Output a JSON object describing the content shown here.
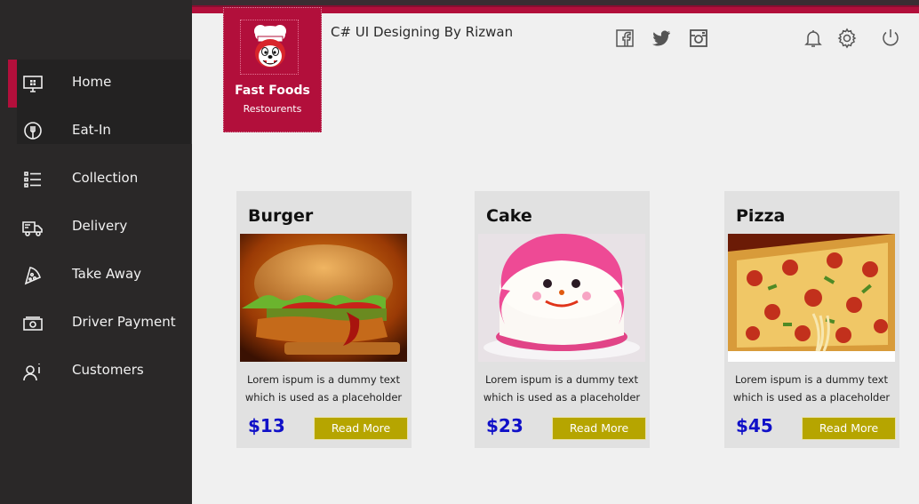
{
  "app": {
    "title": "C# UI Designing By Rizwan"
  },
  "brand": {
    "name": "Fast Foods",
    "subtitle": "Restourents",
    "color": "#b20f3b"
  },
  "sidebar": {
    "items": [
      {
        "label": "Home",
        "icon": "monitor-icon",
        "active": true
      },
      {
        "label": "Eat-In",
        "icon": "dine-in-icon"
      },
      {
        "label": "Collection",
        "icon": "list-icon"
      },
      {
        "label": "Delivery",
        "icon": "truck-icon"
      },
      {
        "label": "Take Away",
        "icon": "pizza-slice-icon"
      },
      {
        "label": "Driver Payment",
        "icon": "cash-icon"
      },
      {
        "label": "Customers",
        "icon": "user-info-icon"
      }
    ]
  },
  "header": {
    "social_icons": [
      "facebook-icon",
      "twitter-icon",
      "instagram-icon"
    ],
    "action_icons": [
      "bell-icon",
      "gear-icon",
      "power-icon"
    ]
  },
  "cards": [
    {
      "title": "Burger",
      "desc_line1": "Lorem ispum is a dummy text",
      "desc_line2": "which is used as a placeholder",
      "price": "$13",
      "button": "Read More",
      "image": "burger-image"
    },
    {
      "title": "Cake",
      "desc_line1": "Lorem ispum is a dummy text",
      "desc_line2": "which is used as a placeholder",
      "price": "$23",
      "button": "Read More",
      "image": "cake-image"
    },
    {
      "title": "Pizza",
      "desc_line1": "Lorem ispum is a dummy text",
      "desc_line2": "which is used as a placeholder",
      "price": "$45",
      "button": "Read More",
      "image": "pizza-image"
    }
  ],
  "colors": {
    "sidebar_bg": "#2a2828",
    "content_bg": "#f0f0f0",
    "accent": "#b20f3b",
    "price": "#1010c8",
    "button": "#b6a500"
  }
}
